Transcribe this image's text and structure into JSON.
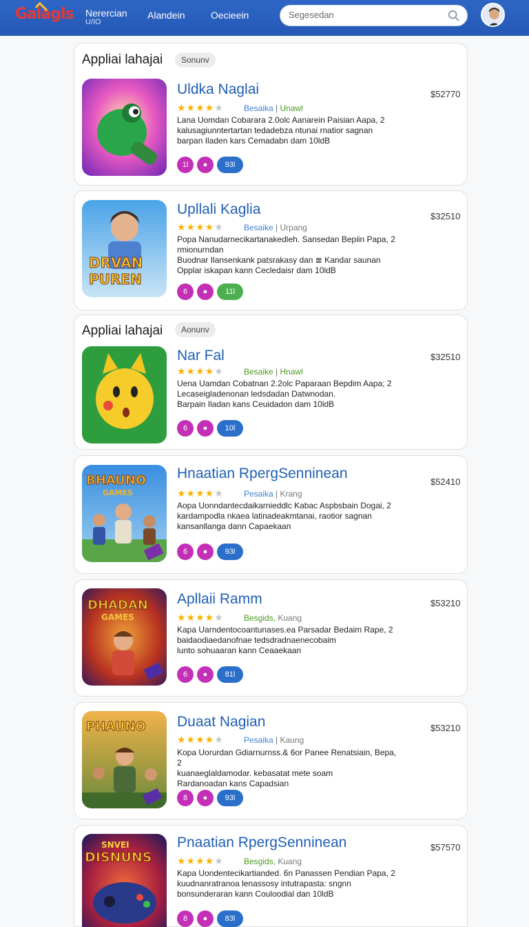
{
  "header": {
    "logo": "Galagls",
    "nav": [
      {
        "label": "Nerercian",
        "sub": "U/IO"
      },
      {
        "label": "Alandein"
      },
      {
        "label": "Oecieein"
      }
    ],
    "search_placeholder": "Segesedan"
  },
  "sections": [
    {
      "title": "Appliai lahajai",
      "badge": "Sonunv"
    },
    {
      "title": "Appliai lahajai",
      "badge": "Aonunv"
    }
  ],
  "apps": [
    {
      "title": "Uldka Naglai",
      "price": "$52770",
      "rating_a": "Besaika",
      "rating_b": "Unawl",
      "rating_color": "#4a9a1e",
      "desc": [
        "Lana Uomdan Cobarara 2.0olc Aanarein Paisian Aapa, 2",
        "kalusagiunntertartan tedadebza ntunai rnatior sagnan",
        "barpan Iladen kars Cemadabn dam 10ldB"
      ],
      "chips": [
        "1l",
        "",
        "93l"
      ]
    },
    {
      "title": "Upllali Kaglia",
      "price": "$32510",
      "rating_a": "Besaike",
      "rating_b": "Urpang",
      "rating_color": "#3c7fd8",
      "desc": [
        "Popa Nanudarnecikartanakedleh. Sansedan Bepiin Papa, 2",
        "rmionurndan",
        "Buodnar Ilansenkank patsrakasy dan ≣ Kandar saunan",
        "Opplar iskapan kann Cecledaisr dam 10ldB"
      ],
      "chips": [
        "6",
        "",
        "11l"
      ]
    },
    {
      "title": "Nar Fal",
      "price": "$32510",
      "rating_a": "Besaike",
      "rating_b": "Hnawl",
      "rating_color": "#4a9a1e",
      "desc": [
        "Uena Uamdan Cobatnan 2.2olc Paparaan Bepdim Aapa; 2",
        "Lecaseigladenonan ledsdadan Datwnodan.",
        "Barpain Iladan kans Ceuidadon dam 10ldB"
      ],
      "chips": [
        "6",
        "",
        "10l"
      ]
    },
    {
      "title": "Hnaatian RpergSenninean",
      "price": "$52410",
      "rating_a": "Pesaika",
      "rating_b": "Krang",
      "rating_color": "#3c7fd8",
      "desc": [
        "Aopa Uonndantecdaikarnieddlc Kabac Aspbsbain Dogai, 2",
        "kardampodla nkaea latinadeakmtanai, raotior sagnan",
        "kansanllanga dann Capaekaan"
      ],
      "chips": [
        "6",
        "",
        "93l"
      ]
    },
    {
      "title": "Apllaii Ramm",
      "price": "$53210",
      "rating_a": "Besgids,",
      "rating_b": "Kuang",
      "rating_color": "#4a9a1e",
      "desc": [
        "Kapa Uarndentocoantunases.ea Parsadar Bedaim Rape, 2",
        "baidaodiaedanofnae tedsdradnaenecobaim",
        "lunto sohuaaran kann Ceaaekaan"
      ],
      "chips": [
        "6",
        "",
        "81l"
      ]
    },
    {
      "title": "Duaat Nagian",
      "price": "$53210",
      "rating_a": "Pesaika",
      "rating_b": "Kaung",
      "rating_color": "#3c7fd8",
      "desc": [
        "Kopa Uorurdan Gdiarnurnss.& 6or Panee Renatsiain, Bepa, 2",
        "kuanaeglaldamodar. kebasatat mete soam",
        "Rardanoadan kans Capadsian"
      ],
      "chips": [
        "8",
        "",
        "93l"
      ]
    },
    {
      "title": "Pnaatian RpergSenninean",
      "price": "$57570",
      "rating_a": "Besgids,",
      "rating_b": "Kuang",
      "rating_color": "#4a9a1e",
      "desc": [
        "Kapa Uondentecikartianded. 6n Panassen Pendian Papa, 2",
        "kuudnanratranoa lenassosy intutrapasta: sngnn",
        "bonsunderaran kann Couloodial dan 10ldB"
      ],
      "chips": [
        "8",
        "",
        "83l"
      ]
    }
  ],
  "colors": {
    "header": "#2a5fbf",
    "title_blue": "#1f5fb3",
    "chip_magenta": "#c42fb7",
    "chip_blue": "#2a6fc9",
    "chip_green": "#4caf50",
    "star": "#f4b400"
  },
  "icons": [
    "search-icon",
    "avatar",
    "star-icon",
    "like-icon"
  ]
}
